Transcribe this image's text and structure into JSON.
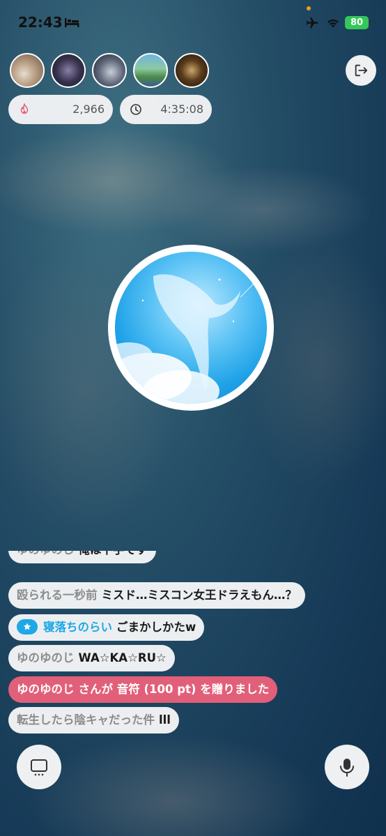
{
  "status": {
    "time": "22:43",
    "battery": "80"
  },
  "header": {
    "listeners": [
      "avatar-cat",
      "avatar-person",
      "avatar-bike",
      "avatar-island",
      "avatar-eyes"
    ],
    "exit_icon": "exit-icon"
  },
  "stats": {
    "points": "2,966",
    "elapsed": "4:35:08"
  },
  "chat": [
    {
      "name": "ゆのゆのじ",
      "message": "俺は下手です",
      "type": "normal"
    },
    {
      "name": "殴られる一秒前",
      "message": "ミスド…ミスコン女王ドラえもん…？",
      "type": "normal"
    },
    {
      "name": "寝落ちのらい",
      "message": "ごまかしかたw",
      "type": "badge"
    },
    {
      "name": "ゆのゆのじ",
      "message": "WA☆KA☆RU☆",
      "type": "normal"
    },
    {
      "name": "ゆのゆのじ",
      "message": "さんが 音符 (100 pt) を贈りました",
      "type": "gift"
    },
    {
      "name": "転生したら陰キャだった件",
      "message": "lll",
      "type": "normal"
    }
  ],
  "colors": {
    "gift": "#e25f79",
    "badge": "#1fa8e6",
    "battery": "#34c759"
  }
}
